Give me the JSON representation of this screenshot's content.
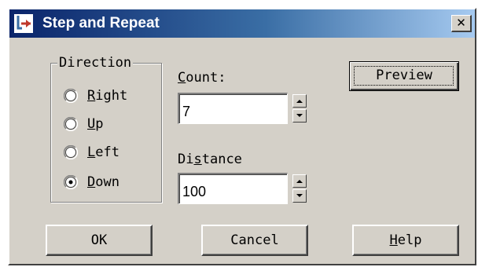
{
  "window": {
    "title": "Step and Repeat",
    "close_glyph": "✕",
    "icon": "app-icon"
  },
  "direction": {
    "legend": "Direction",
    "options": [
      {
        "label": "Right",
        "mnemonic": "R",
        "rest": "ight",
        "selected": false
      },
      {
        "label": "Up",
        "mnemonic": "U",
        "rest": "p",
        "selected": false
      },
      {
        "label": "Left",
        "mnemonic": "L",
        "rest": "eft",
        "selected": false
      },
      {
        "label": "Down",
        "mnemonic": "D",
        "rest": "own",
        "selected": true
      }
    ]
  },
  "count": {
    "label": "Count:",
    "mnemonic": "C",
    "rest": "ount:",
    "value": "7"
  },
  "distance": {
    "label": "Distance",
    "pre": "Di",
    "mnemonic": "s",
    "rest": "tance",
    "value": "100"
  },
  "buttons": {
    "preview": "Preview",
    "ok": "OK",
    "cancel": "Cancel",
    "help": "Help",
    "help_mnemonic": "H",
    "help_rest": "elp"
  },
  "colors": {
    "face": "#d4d0c8",
    "title_start": "#0a246a",
    "title_end": "#a6caf0",
    "title_text": "#ffffff"
  }
}
